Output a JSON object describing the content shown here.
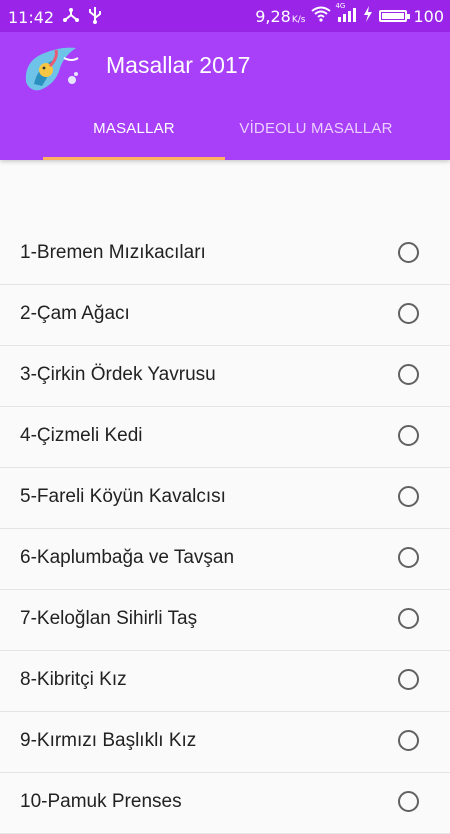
{
  "status_bar": {
    "time": "11:42",
    "speed": "9,28",
    "speed_unit": "K/s",
    "network_type": "4G",
    "battery": "100",
    "battery_level": 1.0,
    "icons": [
      "share-icon",
      "usb-icon",
      "wifi-icon",
      "signal-icon",
      "charging-icon",
      "battery-icon"
    ]
  },
  "app_bar": {
    "title": "Masallar 2017",
    "logo_icon": "fairy-tale-logo",
    "accent_color": "#a83ff9",
    "indicator_color": "#ffb060"
  },
  "tabs": [
    {
      "label": "MASALLAR",
      "selected": true
    },
    {
      "label": "VİDEOLU MASALLAR",
      "selected": false
    }
  ],
  "list": {
    "items": [
      {
        "label": "1-Bremen Mızıkacıları"
      },
      {
        "label": "2-Çam Ağacı"
      },
      {
        "label": "3-Çirkin Ördek Yavrusu"
      },
      {
        "label": "4-Çizmeli Kedi"
      },
      {
        "label": "5-Fareli Köyün Kavalcısı"
      },
      {
        "label": "6-Kaplumbağa ve Tavşan"
      },
      {
        "label": "7-Keloğlan Sihirli Taş"
      },
      {
        "label": "8-Kibritçi Kız"
      },
      {
        "label": "9-Kırmızı Başlıklı Kız"
      },
      {
        "label": "10-Pamuk Prenses"
      }
    ]
  }
}
